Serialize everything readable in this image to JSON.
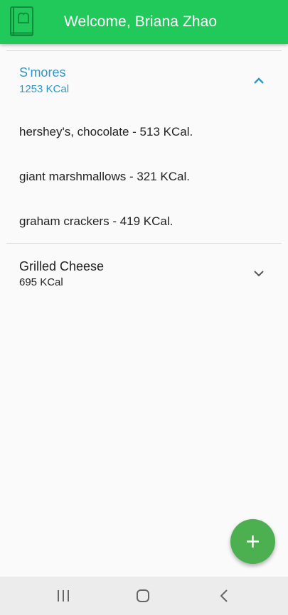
{
  "appbar": {
    "title": "Welcome, Briana Zhao",
    "logo_icon": "recipe-book-icon"
  },
  "recipes": [
    {
      "name": "S'mores",
      "calories": "1253 KCal",
      "expanded": true,
      "ingredients": [
        "hershey's, chocolate - 513 KCal.",
        "giant marshmallows - 321 KCal.",
        "graham crackers - 419 KCal."
      ]
    },
    {
      "name": "Grilled Cheese",
      "calories": "695 KCal",
      "expanded": false,
      "ingredients": []
    }
  ],
  "fab": {
    "icon": "plus-icon"
  },
  "navbar": {
    "icons": [
      "recent-apps-icon",
      "home-icon",
      "back-icon"
    ]
  },
  "colors": {
    "appbar": "#21c95a",
    "accent": "#2f96c8",
    "fab": "#4caf50",
    "text": "#222222"
  }
}
